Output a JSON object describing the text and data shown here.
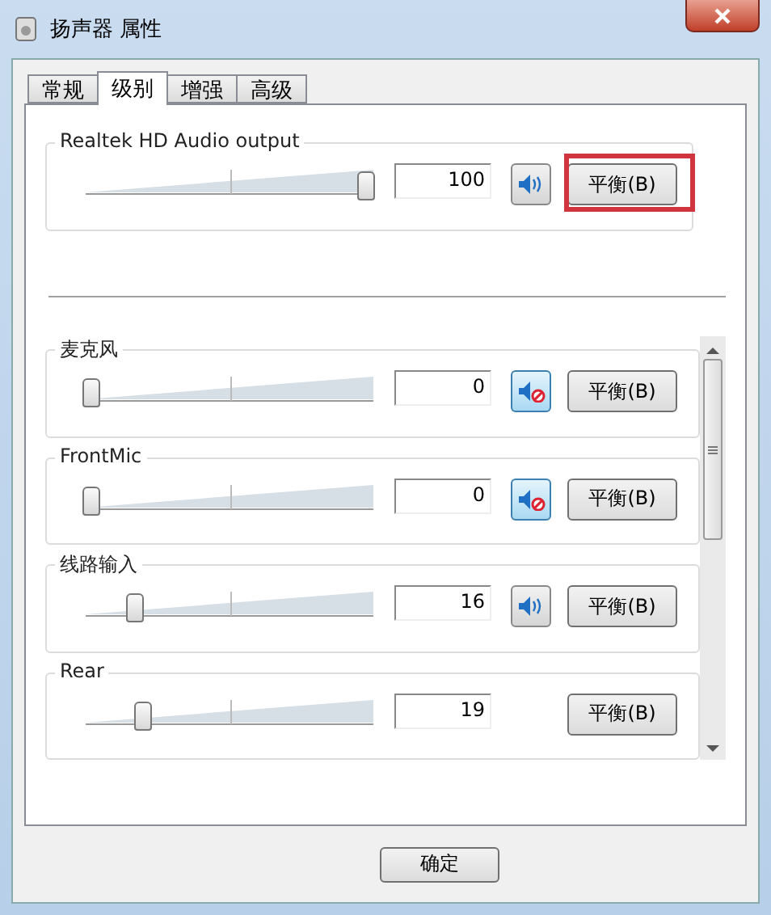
{
  "window": {
    "title": "扬声器 属性"
  },
  "tabs": [
    {
      "label": "常规",
      "selected": false
    },
    {
      "label": "级别",
      "selected": true
    },
    {
      "label": "增强",
      "selected": false
    },
    {
      "label": "高级",
      "selected": false
    }
  ],
  "output": {
    "name": "Realtek HD Audio output",
    "level": 1,
    "value": "100",
    "muted": false,
    "balance": "平衡(B)",
    "highlighted": true
  },
  "channels": [
    {
      "name": "麦克风",
      "level": 0,
      "value": "0",
      "muted": true,
      "balance": "平衡(B)"
    },
    {
      "name": "FrontMic",
      "level": 0,
      "value": "0",
      "muted": true,
      "balance": "平衡(B)"
    },
    {
      "name": "线路输入",
      "level": 0.16,
      "value": "16",
      "muted": false,
      "balance": "平衡(B)"
    },
    {
      "name": "Rear",
      "level": 0.19,
      "value": "19",
      "balance": "平衡(B)"
    }
  ],
  "buttons": [
    "确定"
  ]
}
